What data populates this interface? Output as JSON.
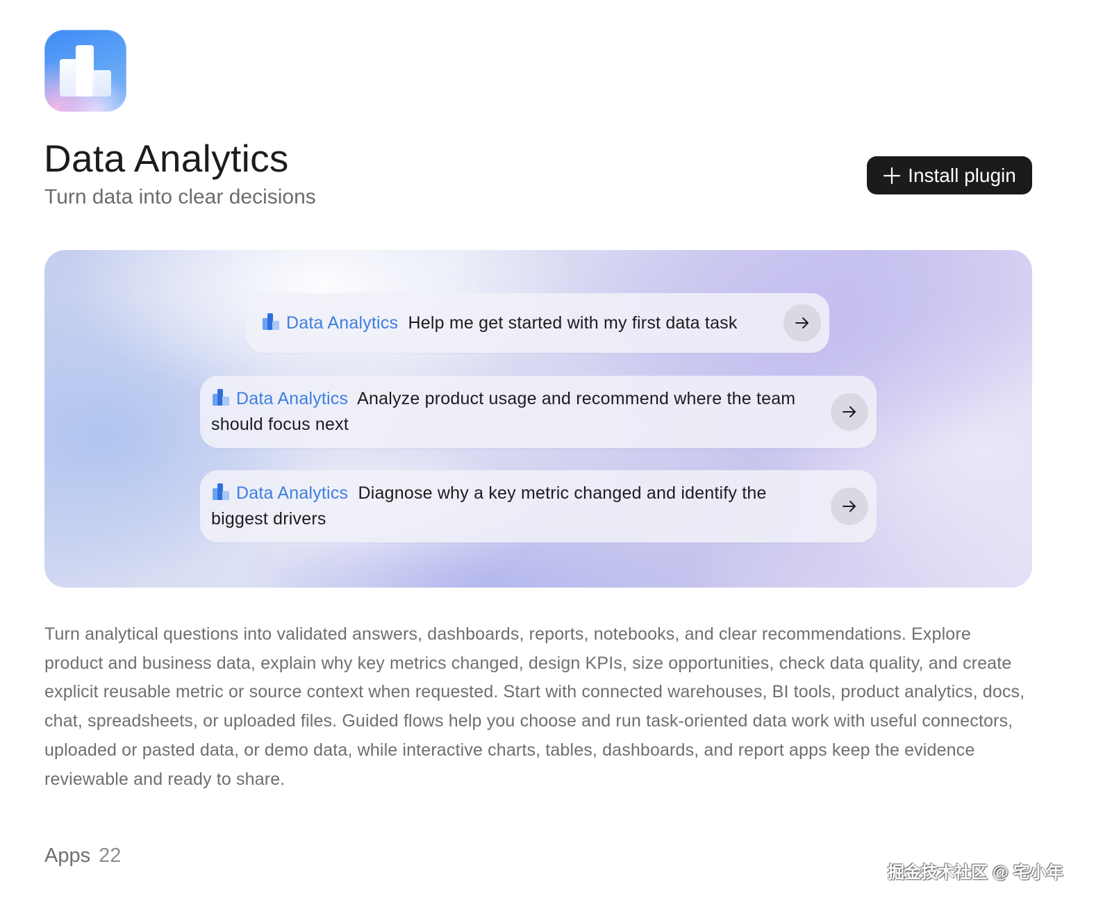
{
  "plugin": {
    "title": "Data Analytics",
    "subtitle": "Turn data into clear decisions",
    "icon": "bar-chart-icon",
    "install_label": "Install plugin"
  },
  "prompts": [
    {
      "tag": "Data Analytics",
      "text": "Help me get started with my first data task"
    },
    {
      "tag": "Data Analytics",
      "text": "Analyze product usage and recommend where the team should focus next"
    },
    {
      "tag": "Data Analytics",
      "text": "Diagnose why a key metric changed and identify the biggest drivers"
    }
  ],
  "description": "Turn analytical questions into validated answers, dashboards, reports, notebooks, and clear recommendations. Explore product and business data, explain why key metrics changed, design KPIs, size opportunities, check data quality, and create explicit reusable metric or source context when requested. Start with connected warehouses, BI tools, product analytics, docs, chat, spreadsheets, or uploaded files. Guided flows help you choose and run task-oriented data work with useful connectors, uploaded or pasted data, or demo data, while interactive charts, tables, dashboards, and report apps keep the evidence reviewable and ready to share.",
  "apps": {
    "label": "Apps",
    "count": "22"
  },
  "watermark": "掘金技术社区 @ 宅小年",
  "colors": {
    "accent": "#3c7fe0",
    "button_bg": "#1b1b1d",
    "text_primary": "#1c1c1e",
    "text_secondary": "#6e6e73"
  }
}
